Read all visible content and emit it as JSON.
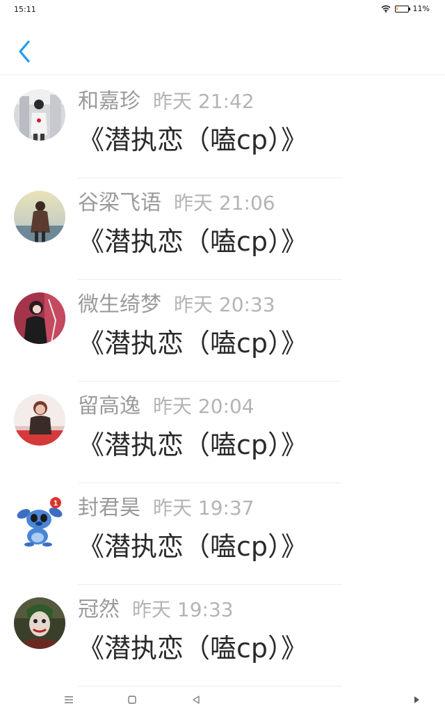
{
  "status_bar": {
    "time": "15:11",
    "battery": "11%",
    "battery_level": 0.11
  },
  "header": {
    "back_icon": "chevron-left-icon",
    "accent": "#1e9bf0"
  },
  "comments": [
    {
      "user": "和嘉珍",
      "time": "昨天 21:42",
      "text": "《潜执恋（嗑cp）》",
      "avatar": "avatar-photo-street"
    },
    {
      "user": "谷梁飞语",
      "time": "昨天 21:06",
      "text": "《潜执恋（嗑cp）》",
      "avatar": "avatar-photo-sunset"
    },
    {
      "user": "微生绮梦",
      "time": "昨天 20:33",
      "text": "《潜执恋（嗑cp）》",
      "avatar": "avatar-photo-redwall"
    },
    {
      "user": "留高逸",
      "time": "昨天 20:04",
      "text": "《潜执恋（嗑cp）》",
      "avatar": "avatar-photo-portrait"
    },
    {
      "user": "封君昊",
      "time": "昨天 19:37",
      "text": "《潜执恋（嗑cp）》",
      "avatar": "avatar-cartoon-stitch"
    },
    {
      "user": "冠然",
      "time": "昨天 19:33",
      "text": "《潜执恋（嗑cp）》",
      "avatar": "avatar-photo-joker"
    }
  ],
  "nav_bar": {
    "icons": [
      "menu-icon",
      "home-square-icon",
      "back-triangle-icon",
      "play-triangle-icon"
    ]
  }
}
